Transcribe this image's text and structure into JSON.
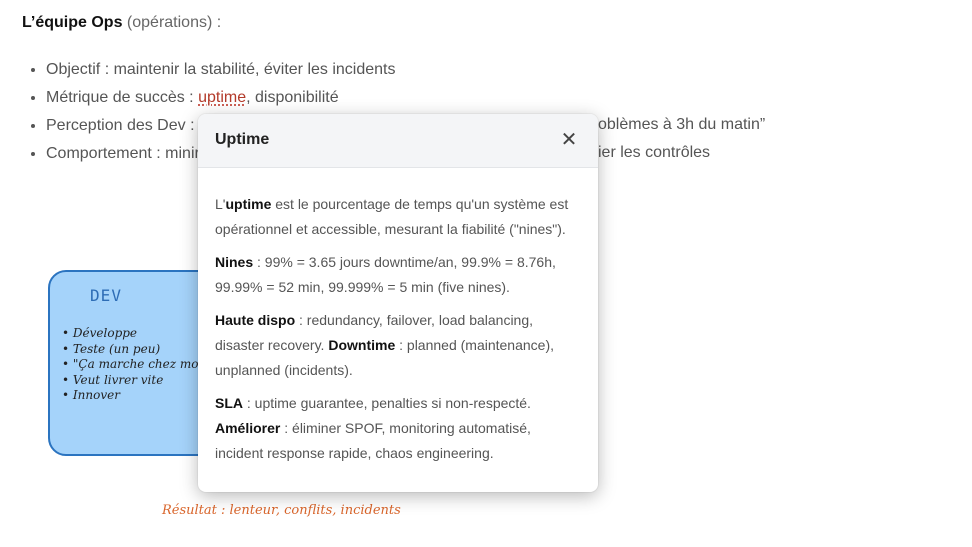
{
  "section": {
    "title": "L’équipe Ops",
    "subtitle": "(opérations) :"
  },
  "points": [
    {
      "text": "Objectif : maintenir la stabilité, éviter les incidents"
    },
    {
      "prefix": "Métrique de succès : ",
      "term": "uptime",
      "suffix": ", disponibilité"
    },
    {
      "text": "Perception des Dev :",
      "tail": "oblèmes à 3h du matin”"
    },
    {
      "text": "Comportement : minir",
      "tail": "ier les contrôles"
    }
  ],
  "sketch": {
    "title": "DEV",
    "items": [
      "Développe",
      "Teste (un peu)",
      "\"Ça marche chez moi\"",
      "Veut livrer vite",
      "Innover"
    ],
    "result": "Résultat : lenteur, conflits, incidents",
    "colors": {
      "fill": "#a5d3fa",
      "stroke": "#2b74c0",
      "result": "#d9652b"
    }
  },
  "modal": {
    "title": "Uptime",
    "close_icon": "close-icon",
    "p1": {
      "pre": "L'",
      "b1": "uptime",
      "t1": " est le pourcentage de temps qu'un système est opérationnel et accessible, mesurant la fiabilité (\"nines\")."
    },
    "p2": {
      "b1": "Nines",
      "t1": " : 99% = 3.65 jours downtime/an, 99.9% = 8.76h, 99.99% = 52 min, 99.999% = 5 min (five nines)."
    },
    "p3": {
      "b1": "Haute dispo",
      "t1": " : redundancy, failover, load balancing, disaster recovery. ",
      "b2": "Downtime",
      "t2": " : planned (maintenance), unplanned (incidents)."
    },
    "p4": {
      "b1": "SLA",
      "t1": " : uptime guarantee, penalties si non-respecté."
    },
    "p5": {
      "b1": "Améliorer",
      "t1": " : éliminer SPOF, monitoring automatisé, incident response rapide, chaos engineering."
    }
  }
}
